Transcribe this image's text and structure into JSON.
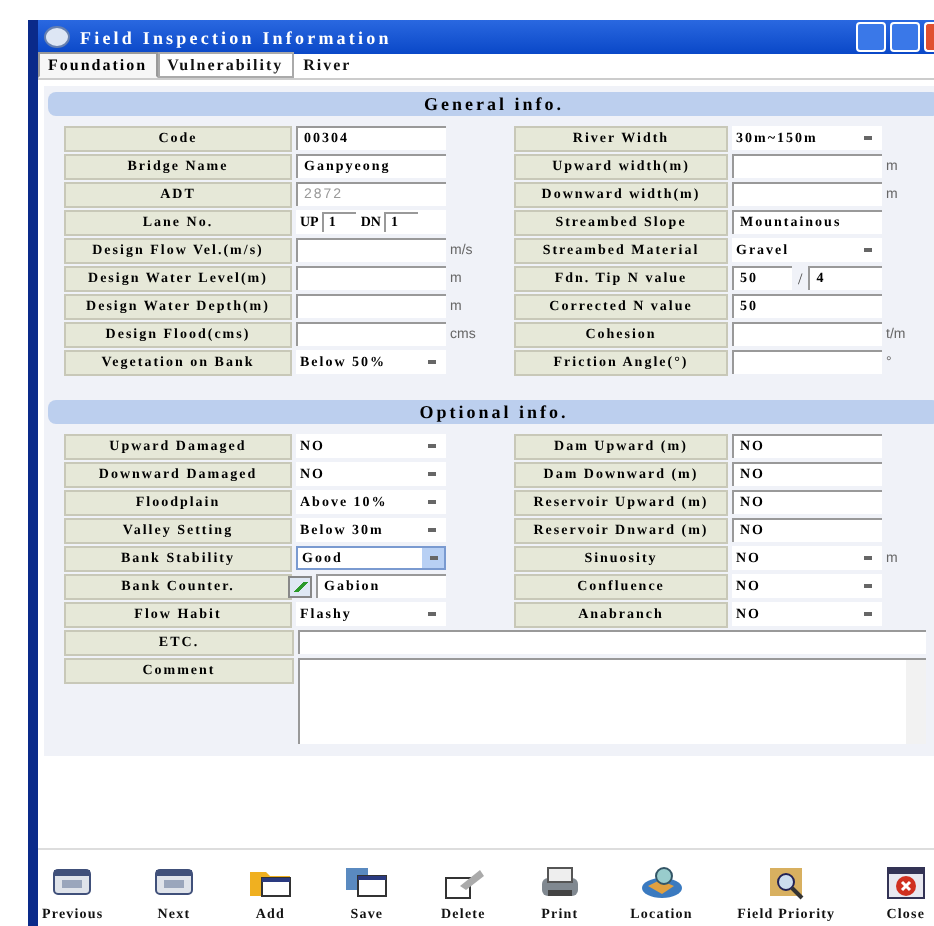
{
  "window": {
    "title": "Field Inspection Information"
  },
  "tabs": [
    {
      "label": "Foundation",
      "selected": true
    },
    {
      "label": "Vulnerability",
      "selected": false
    },
    {
      "label": "River",
      "selected": false
    }
  ],
  "general": {
    "title": "General info.",
    "rows": [
      {
        "left": {
          "label": "Code",
          "kind": "text",
          "value": "00304"
        },
        "right": {
          "label": "River Width",
          "kind": "select",
          "value": "30m~150m",
          "focused": false
        }
      },
      {
        "left": {
          "label": "Bridge Name",
          "kind": "text",
          "value": "Ganpyeong"
        },
        "right": {
          "label": "Upward width(m)",
          "kind": "text",
          "unit": "m"
        }
      },
      {
        "left": {
          "label": "ADT",
          "kind": "text",
          "value": "2872",
          "disabled": true
        },
        "right": {
          "label": "Downward width(m)",
          "kind": "text",
          "unit": "m"
        }
      },
      {
        "left": {
          "label": "Lane No.",
          "kind": "lane",
          "up_label": "UP",
          "up": "1",
          "dn_label": "DN",
          "dn": "1"
        },
        "right": {
          "label": "Streambed Slope",
          "kind": "text",
          "value": "Mountainous"
        }
      },
      {
        "left": {
          "label": "Design Flow Vel.(m/s)",
          "kind": "text",
          "unit": "m/s"
        },
        "right": {
          "label": "Streambed Material",
          "kind": "select",
          "value": "Gravel",
          "focused": false
        }
      },
      {
        "left": {
          "label": "Design Water Level(m)",
          "kind": "text",
          "unit": "m"
        },
        "right": {
          "label": "Fdn. Tip N value",
          "kind": "pair",
          "value": "50",
          "separator": "/",
          "value2": "4"
        }
      },
      {
        "left": {
          "label": "Design Water Depth(m)",
          "kind": "text",
          "unit": "m"
        },
        "right": {
          "label": "Corrected N value",
          "kind": "text",
          "value": "50"
        }
      },
      {
        "left": {
          "label": "Design Flood(cms)",
          "kind": "text",
          "unit": "cms"
        },
        "right": {
          "label": "Cohesion",
          "kind": "text",
          "unit": "t/m"
        }
      },
      {
        "left": {
          "label": "Vegetation on Bank",
          "kind": "select",
          "value": "Below 50%",
          "focused": false
        },
        "right": {
          "label": "Friction Angle(°)",
          "kind": "text",
          "unit": "°"
        }
      }
    ]
  },
  "optional": {
    "title": "Optional info.",
    "rows": [
      {
        "left": {
          "label": "Upward Damaged",
          "kind": "select",
          "value": "NO",
          "focused": false
        },
        "right": {
          "label": "Dam Upward (m)",
          "kind": "text",
          "value": "NO"
        }
      },
      {
        "left": {
          "label": "Downward Damaged",
          "kind": "select",
          "value": "NO",
          "focused": false
        },
        "right": {
          "label": "Dam Downward (m)",
          "kind": "text",
          "value": "NO"
        }
      },
      {
        "left": {
          "label": "Floodplain",
          "kind": "select",
          "value": "Above 10%",
          "focused": false
        },
        "right": {
          "label": "Reservoir Upward (m)",
          "kind": "text",
          "value": "NO"
        }
      },
      {
        "left": {
          "label": "Valley Setting",
          "kind": "select",
          "value": "Below 30m",
          "focused": false
        },
        "right": {
          "label": "Reservoir Dnward (m)",
          "kind": "text",
          "value": "NO"
        }
      },
      {
        "left": {
          "label": "Bank Stability",
          "kind": "select",
          "value": "Good",
          "focused": true
        },
        "right": {
          "label": "Sinuosity",
          "kind": "select",
          "value": "NO",
          "focused": false,
          "unit": "m"
        }
      },
      {
        "left": {
          "label": "Bank Counter.",
          "kind": "check",
          "checked": true,
          "value": "Gabion"
        },
        "right": {
          "label": "Confluence",
          "kind": "select",
          "value": "NO",
          "focused": false
        }
      },
      {
        "left": {
          "label": "Flow Habit",
          "kind": "select",
          "value": "Flashy",
          "focused": false
        },
        "right": {
          "label": "Anabranch",
          "kind": "select",
          "value": "NO",
          "focused": false
        }
      }
    ],
    "wide": [
      {
        "label": "ETC.",
        "kind": "line"
      },
      {
        "label": "Comment",
        "kind": "area"
      }
    ]
  },
  "toolbar": [
    {
      "label": "Previous",
      "kind": "previous"
    },
    {
      "label": "Next",
      "kind": "next"
    },
    {
      "label": "Add",
      "kind": "add"
    },
    {
      "label": "Save",
      "kind": "save"
    },
    {
      "label": "Delete",
      "kind": "delete"
    },
    {
      "label": "Print",
      "kind": "print"
    },
    {
      "label": "Location",
      "kind": "location"
    },
    {
      "label": "Field Priority",
      "kind": "priority"
    },
    {
      "label": "Close",
      "kind": "close"
    }
  ]
}
